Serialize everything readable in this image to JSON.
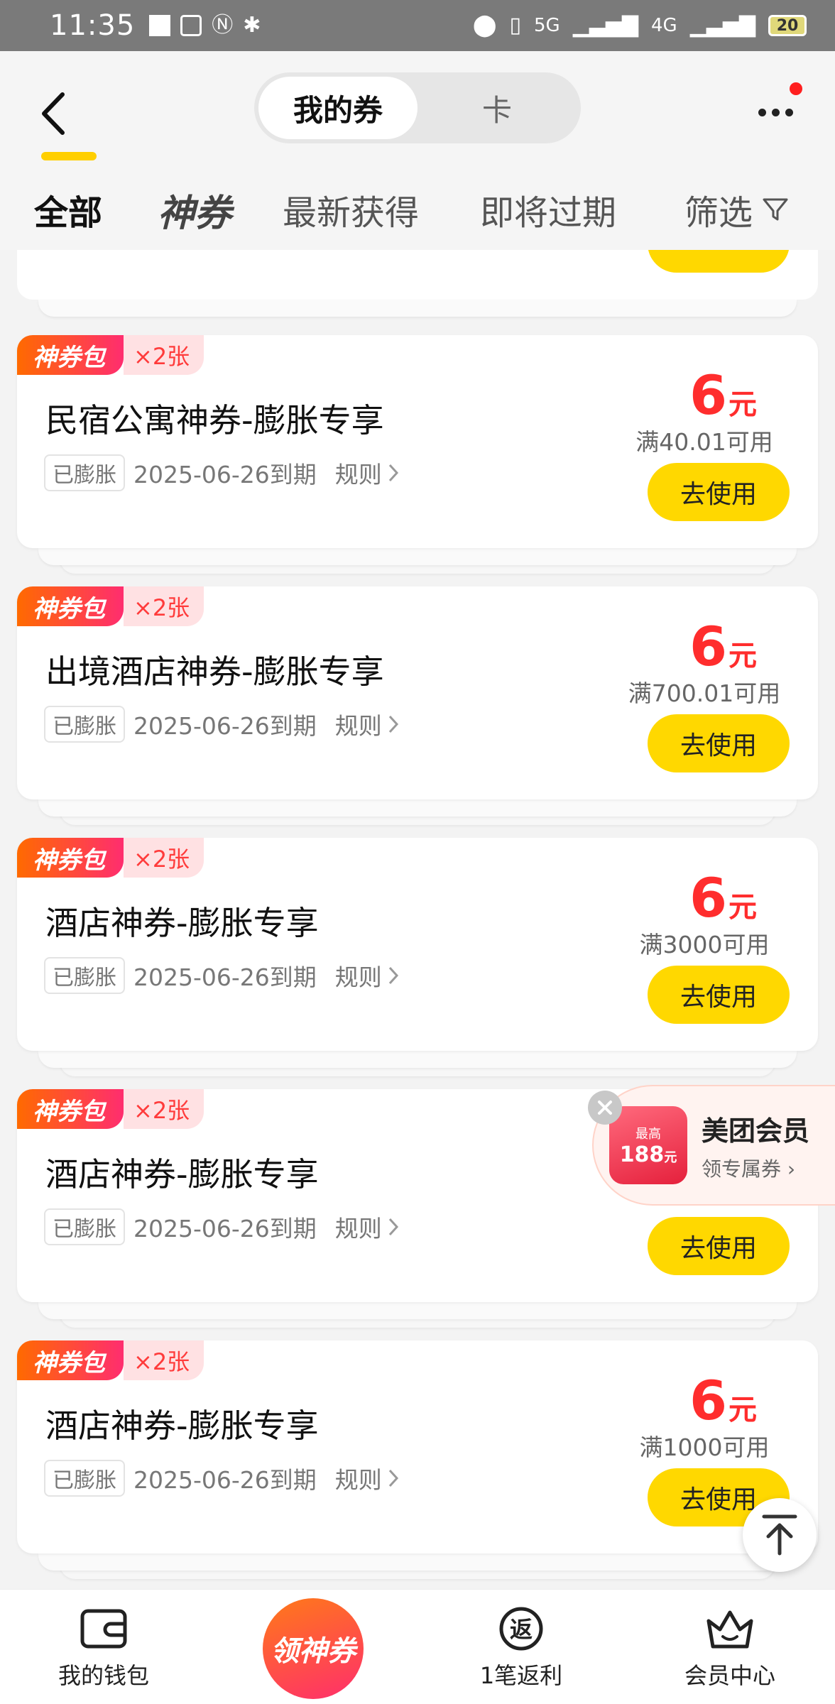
{
  "status_bar": {
    "time": "11:35",
    "battery": "20",
    "network_a": "5G",
    "network_b": "4G"
  },
  "header": {
    "segment_tabs": [
      {
        "label": "我的券",
        "active": true
      },
      {
        "label": "卡",
        "active": false
      }
    ],
    "filter_tabs": [
      {
        "label": "全部",
        "active": true
      },
      {
        "label": "神券",
        "active": false
      },
      {
        "label": "最新获得",
        "active": false
      },
      {
        "label": "即将过期",
        "active": false
      },
      {
        "label": "筛选",
        "active": false
      }
    ]
  },
  "coupons": [
    {
      "badge": "神券包",
      "count": "×2张",
      "title": "民宿公寓神券-膨胀专享",
      "tag": "已膨胀",
      "expiry": "2025-06-26到期",
      "rules": "规则",
      "amount": "6",
      "unit": "元",
      "condition": "满40.01可用",
      "button": "去使用"
    },
    {
      "badge": "神券包",
      "count": "×2张",
      "title": "出境酒店神券-膨胀专享",
      "tag": "已膨胀",
      "expiry": "2025-06-26到期",
      "rules": "规则",
      "amount": "6",
      "unit": "元",
      "condition": "满700.01可用",
      "button": "去使用"
    },
    {
      "badge": "神券包",
      "count": "×2张",
      "title": "酒店神券-膨胀专享",
      "tag": "已膨胀",
      "expiry": "2025-06-26到期",
      "rules": "规则",
      "amount": "6",
      "unit": "元",
      "condition": "满3000可用",
      "button": "去使用"
    },
    {
      "badge": "神券包",
      "count": "×2张",
      "title": "酒店神券-膨胀专享",
      "tag": "已膨胀",
      "expiry": "2025-06-26到期",
      "rules": "规则",
      "amount": "",
      "unit": "",
      "condition": "",
      "button": "去使用"
    },
    {
      "badge": "神券包",
      "count": "×2张",
      "title": "酒店神券-膨胀专享",
      "tag": "已膨胀",
      "expiry": "2025-06-26到期",
      "rules": "规则",
      "amount": "6",
      "unit": "元",
      "condition": "满1000可用",
      "button": "去使用"
    }
  ],
  "promo": {
    "pack_top": "最高",
    "pack_amount": "188",
    "pack_unit": "元",
    "title": "美团会员",
    "subtitle": "领专属券"
  },
  "bottom_nav": [
    {
      "label": "我的钱包"
    },
    {
      "label": "领神券"
    },
    {
      "label": "1笔返利",
      "icon_text": "返"
    },
    {
      "label": "会员中心"
    }
  ],
  "colors": {
    "accent_yellow": "#ffd800",
    "price_red": "#ff2d2d",
    "badge_gradient_start": "#ff6a00",
    "badge_gradient_end": "#ff2d6f"
  }
}
